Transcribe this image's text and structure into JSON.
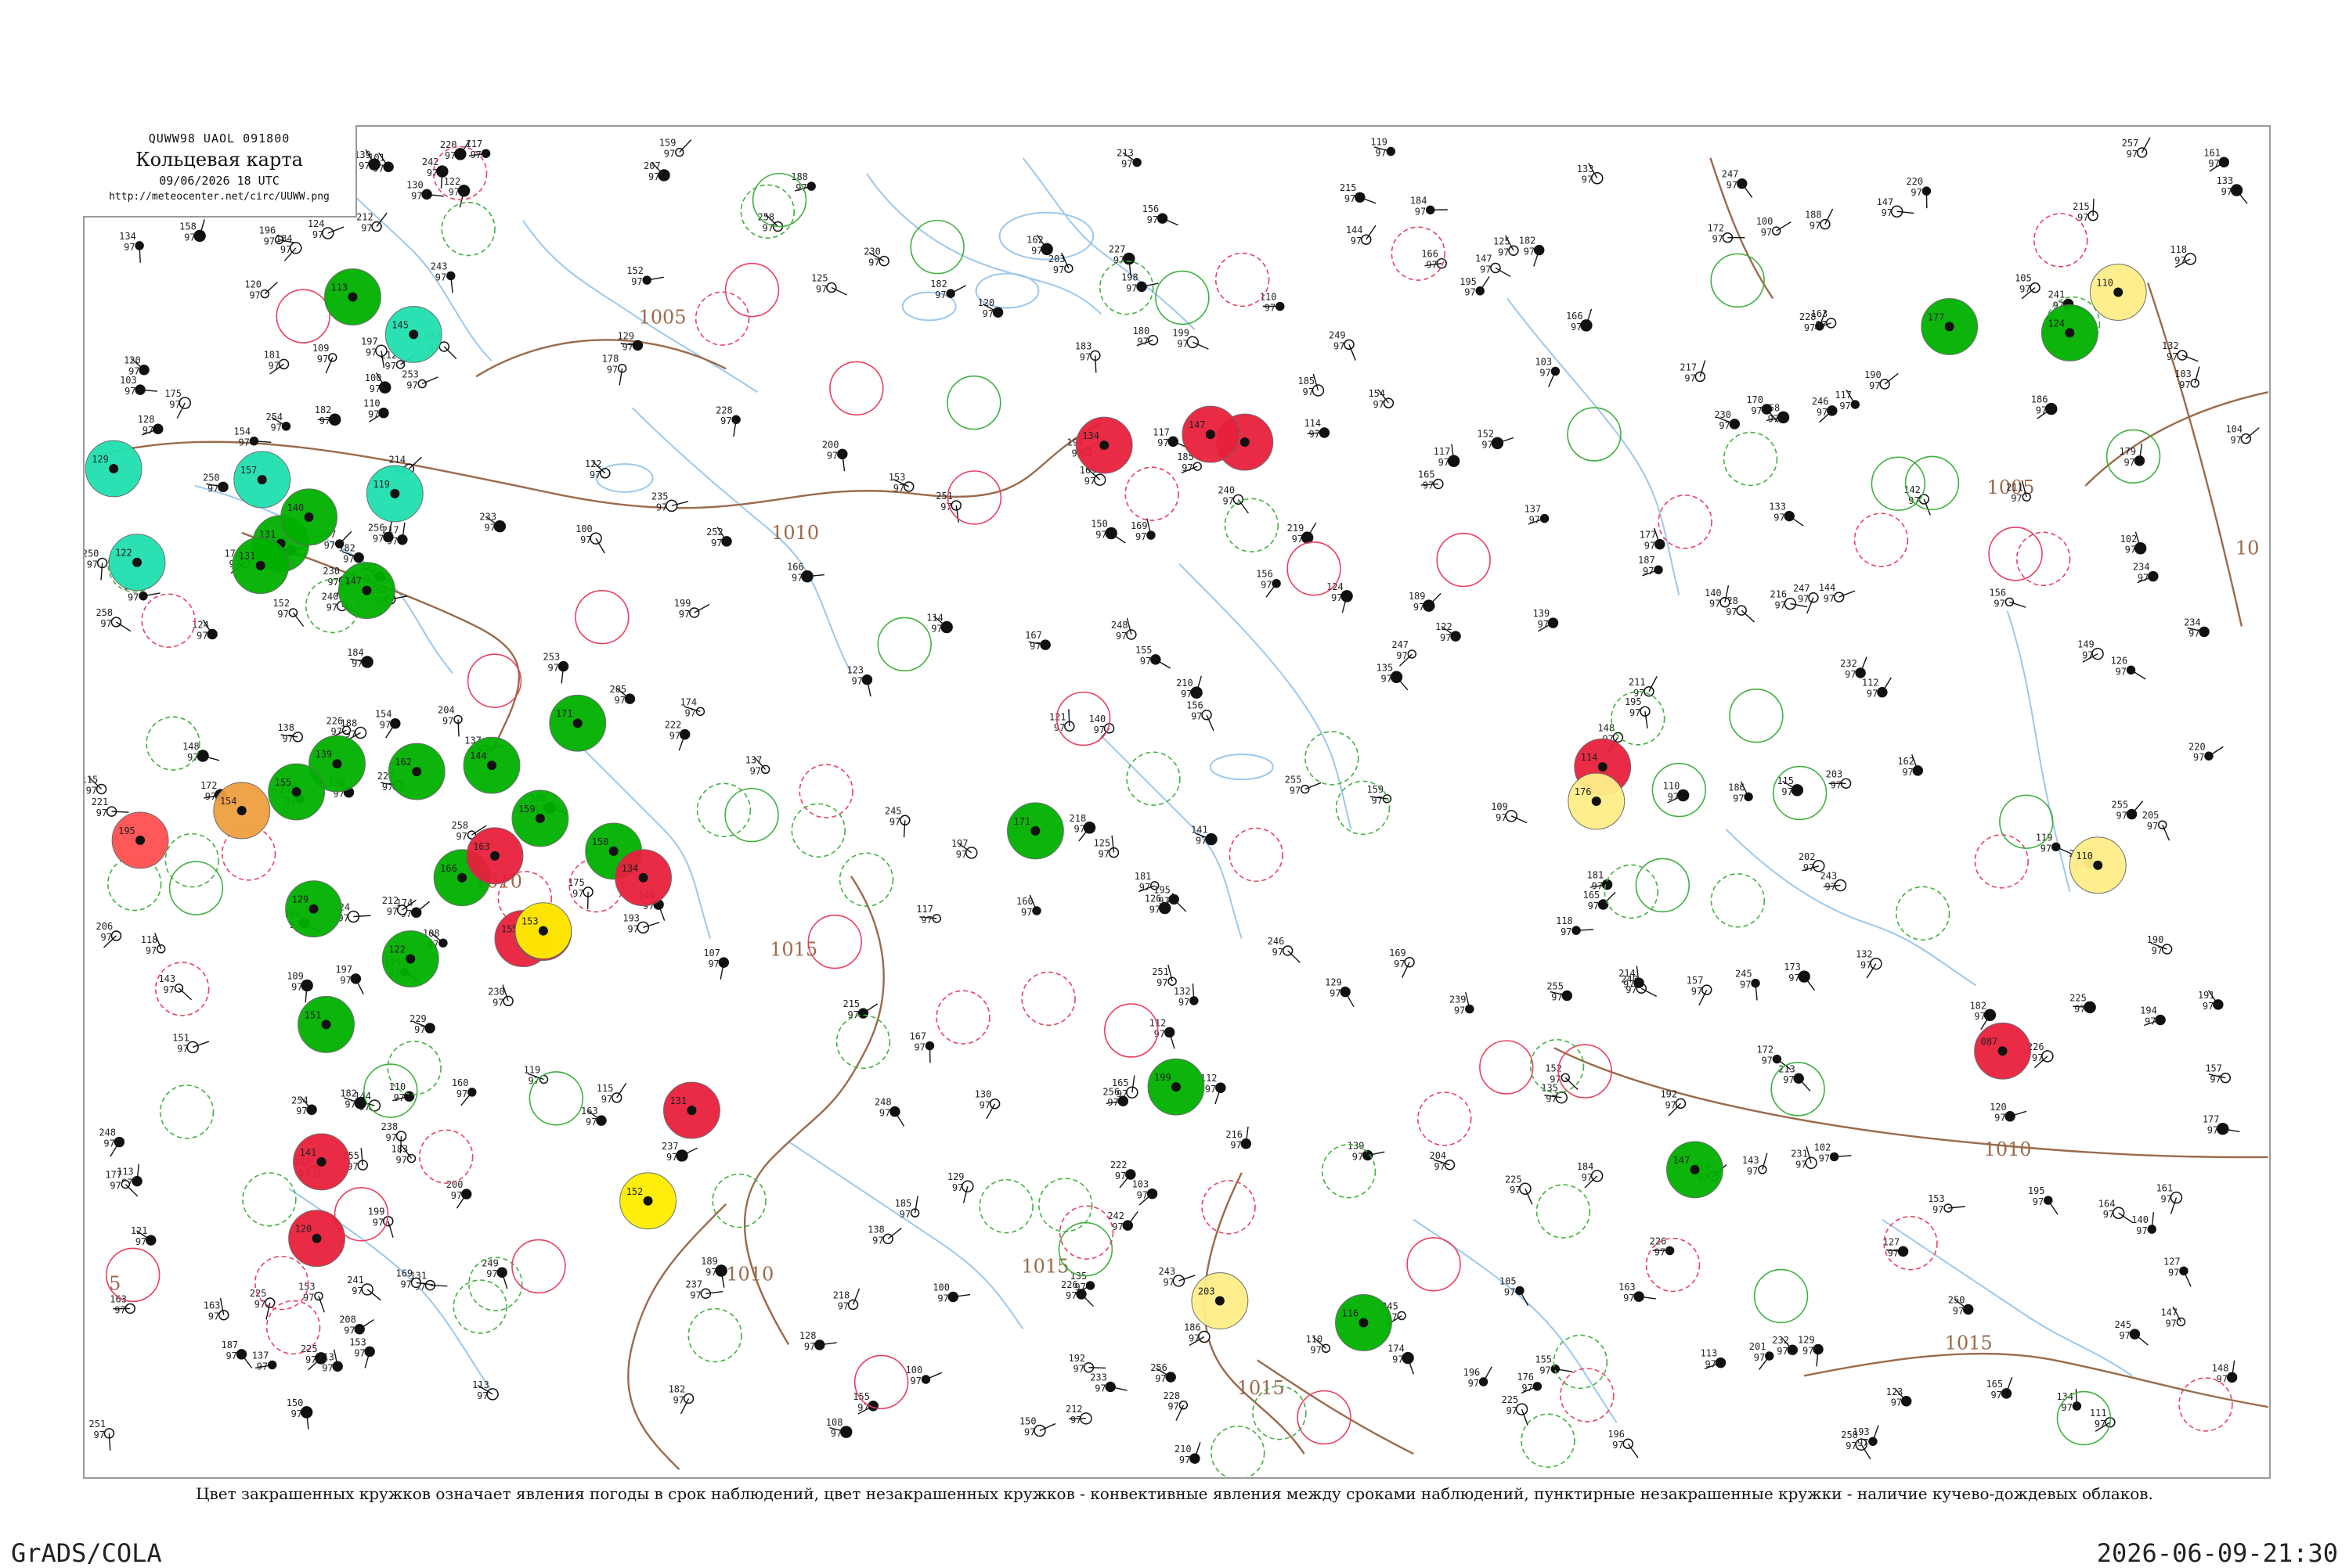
{
  "header": {
    "bulletin": "QUWW98  UAOL  091800",
    "title": "Кольцевая карта",
    "date": "09/06/2026 18 UTC",
    "url": "http://meteocenter.net/circ/UUWW.png"
  },
  "caption": "Цвет закрашенных кружков означает явления погоды в срок наблюдений, цвет незакрашенных кружков - конвективные явления между сроками наблюдений, пунктирные незакрашенные кружки - наличие кучево-дождевых облаков.",
  "footer": {
    "software": "GrADS/COLA",
    "timestamp": "2026-06-09-21:30"
  },
  "colors": {
    "rain": "#00b000",
    "shower": "#20e0b0",
    "thunder": "#e8203c",
    "fog": "#ffee00",
    "haze": "#ffee88",
    "smoke": "#f0a040",
    "squall": "#ff5050",
    "isobar": "#9a6a4a",
    "river": "#9cc8ec"
  },
  "isobars": [
    {
      "label": "1005"
    },
    {
      "label": "1010"
    },
    {
      "label": "1010"
    },
    {
      "label": "1015"
    },
    {
      "label": "1015"
    },
    {
      "label": "1015"
    },
    {
      "label": "1010"
    },
    {
      "label": "1005"
    },
    {
      "label": "1015"
    },
    {
      "label": "1010"
    },
    {
      "label": "5"
    },
    {
      "label": "10"
    }
  ],
  "stations": [
    {
      "type": "shower-filled",
      "code": "129"
    },
    {
      "type": "shower-filled",
      "code": "122"
    },
    {
      "type": "rain-filled",
      "code": "131"
    },
    {
      "type": "rain-filled",
      "code": "113"
    },
    {
      "type": "shower-filled",
      "code": "145"
    },
    {
      "type": "shower-filled",
      "code": "157"
    },
    {
      "type": "shower-filled",
      "code": "119"
    },
    {
      "type": "rain-filled",
      "code": "131"
    },
    {
      "type": "rain-filled",
      "code": "140"
    },
    {
      "type": "rain-filled",
      "code": "147"
    },
    {
      "type": "rain-filled",
      "code": "139"
    },
    {
      "type": "rain-filled",
      "code": "155"
    },
    {
      "type": "rain-filled",
      "code": "162"
    },
    {
      "type": "rain-filled",
      "code": "171"
    },
    {
      "type": "rain-filled",
      "code": "159"
    },
    {
      "type": "rain-filled",
      "code": "144"
    },
    {
      "type": "rain-filled",
      "code": "150"
    },
    {
      "type": "rain-filled",
      "code": "166"
    },
    {
      "type": "rain-filled",
      "code": "129"
    },
    {
      "type": "rain-filled",
      "code": "151"
    },
    {
      "type": "rain-filled",
      "code": "122"
    },
    {
      "type": "thunder-filled",
      "code": "163"
    },
    {
      "type": "thunder-filled",
      "code": "134"
    },
    {
      "type": "thunder-filled",
      "code": "182"
    },
    {
      "type": "thunder-filled",
      "code": "147"
    },
    {
      "type": "thunder-filled",
      "code": "155"
    },
    {
      "type": "thunder-filled",
      "code": "176"
    },
    {
      "type": "thunder-filled",
      "code": "134"
    },
    {
      "type": "thunder-filled",
      "code": "141"
    },
    {
      "type": "thunder-filled",
      "code": "120"
    },
    {
      "type": "thunder-filled",
      "code": "131"
    },
    {
      "type": "thunder-filled",
      "code": "114"
    },
    {
      "type": "thunder-filled",
      "code": "087"
    },
    {
      "type": "fog-filled",
      "code": "153"
    },
    {
      "type": "fog-filled",
      "code": "152"
    },
    {
      "type": "haze-filled",
      "code": "110"
    },
    {
      "type": "haze-filled",
      "code": "110"
    },
    {
      "type": "haze-filled",
      "code": "176"
    },
    {
      "type": "haze-filled",
      "code": "203"
    },
    {
      "type": "smoke-filled",
      "code": "154"
    },
    {
      "type": "squall-filled",
      "code": "195"
    },
    {
      "type": "rain-filled",
      "code": "171"
    },
    {
      "type": "rain-filled",
      "code": "199"
    },
    {
      "type": "rain-filled",
      "code": "177"
    },
    {
      "type": "rain-filled",
      "code": "116"
    },
    {
      "type": "rain-filled",
      "code": "124"
    },
    {
      "type": "rain-filled",
      "code": "147"
    }
  ]
}
